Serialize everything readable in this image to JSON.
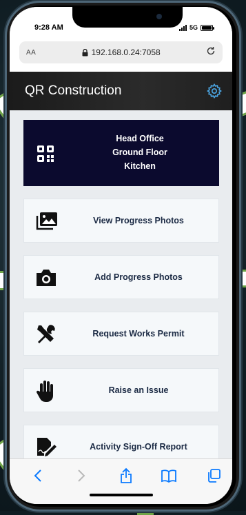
{
  "status_bar": {
    "time": "9:28 AM",
    "network": "5G"
  },
  "browser": {
    "text_size_label": "AA",
    "url": "192.168.0.24:7058",
    "lock_icon": "lock-icon",
    "reload_icon": "reload-icon"
  },
  "app": {
    "title": "QR Construction",
    "settings_icon": "gear-icon"
  },
  "location": {
    "icon": "qr-code-icon",
    "building": "Head Office",
    "floor": "Ground Floor",
    "room": "Kitchen"
  },
  "menu": [
    {
      "label": "View Progress Photos",
      "icon": "photo-gallery-icon"
    },
    {
      "label": "Add Progress Photos",
      "icon": "camera-icon"
    },
    {
      "label": "Request Works Permit",
      "icon": "tools-icon"
    },
    {
      "label": "Raise an Issue",
      "icon": "hand-stop-icon"
    },
    {
      "label": "Activity Sign-Off Report",
      "icon": "sign-off-icon"
    }
  ],
  "toolbar": {
    "back_icon": "chevron-left-icon",
    "forward_icon": "chevron-right-icon",
    "share_icon": "share-icon",
    "bookmarks_icon": "book-icon",
    "tabs_icon": "tabs-icon"
  },
  "colors": {
    "header_bg": "#1f1f1f",
    "location_card_bg": "#0b0a2e",
    "menu_label": "#1b2a44",
    "browser_accent": "#0a7aff",
    "callout_border": "#6fa447"
  }
}
